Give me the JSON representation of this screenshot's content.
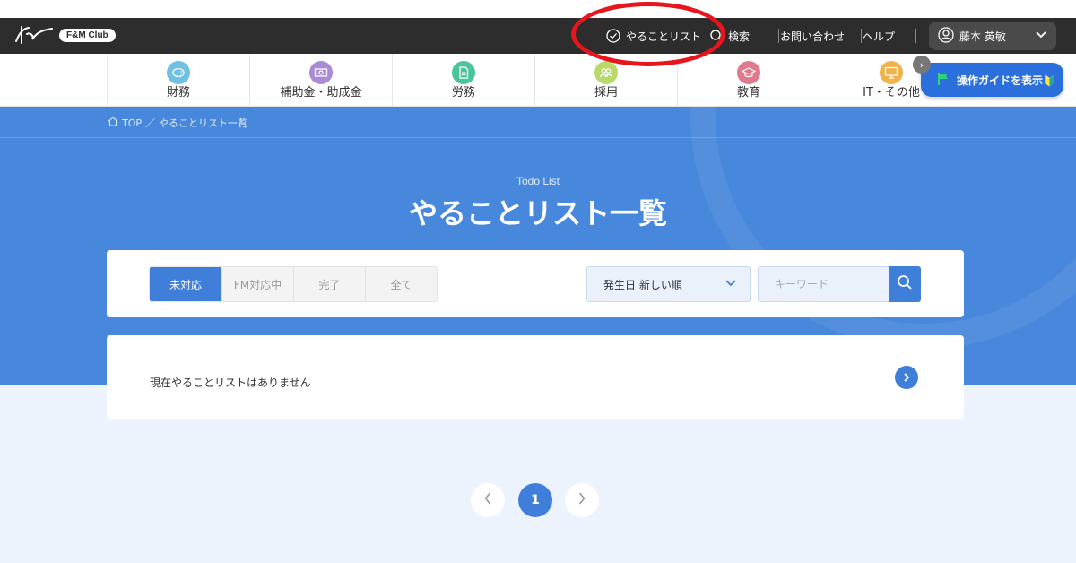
{
  "header": {
    "logo_text": "F&M Club",
    "todo_label": "やることリスト",
    "search_label": "検索",
    "contact_label": "お問い合わせ",
    "help_label": "ヘルプ",
    "user_name": "藤本 英敏"
  },
  "categories": [
    {
      "label": "財務",
      "icon": "piggy-bank-icon",
      "color": "#6ec1e4"
    },
    {
      "label": "補助金・助成金",
      "icon": "money-bill-icon",
      "color": "#a98bd6"
    },
    {
      "label": "労務",
      "icon": "document-icon",
      "color": "#4cc49a"
    },
    {
      "label": "採用",
      "icon": "people-icon",
      "color": "#b9d96a"
    },
    {
      "label": "教育",
      "icon": "graduation-cap-icon",
      "color": "#e27a8d"
    },
    {
      "label": "IT・その他",
      "icon": "monitor-icon",
      "color": "#f0b24a"
    }
  ],
  "guide": {
    "label": "操作ガイドを表示🔰",
    "close_symbol": "›"
  },
  "breadcrumb": {
    "home": "TOP",
    "separator": "／",
    "current": "やることリスト一覧"
  },
  "hero": {
    "subtitle": "Todo List",
    "title": "やることリスト一覧"
  },
  "filter": {
    "tabs": [
      "未対応",
      "FM対応中",
      "完了",
      "全て"
    ],
    "active_tab": "未対応",
    "sort_value": "発生日 新しい順",
    "keyword_placeholder": "キーワード"
  },
  "list": {
    "empty_message": "現在やることリストはありません"
  },
  "pagination": {
    "current": "1",
    "prev_symbol": "‹",
    "next_symbol": "›"
  },
  "colors": {
    "header_bg": "#2d2d2d",
    "hero_bg": "#4787dc",
    "accent": "#3f7fd9",
    "annotation": "#e8141e"
  }
}
